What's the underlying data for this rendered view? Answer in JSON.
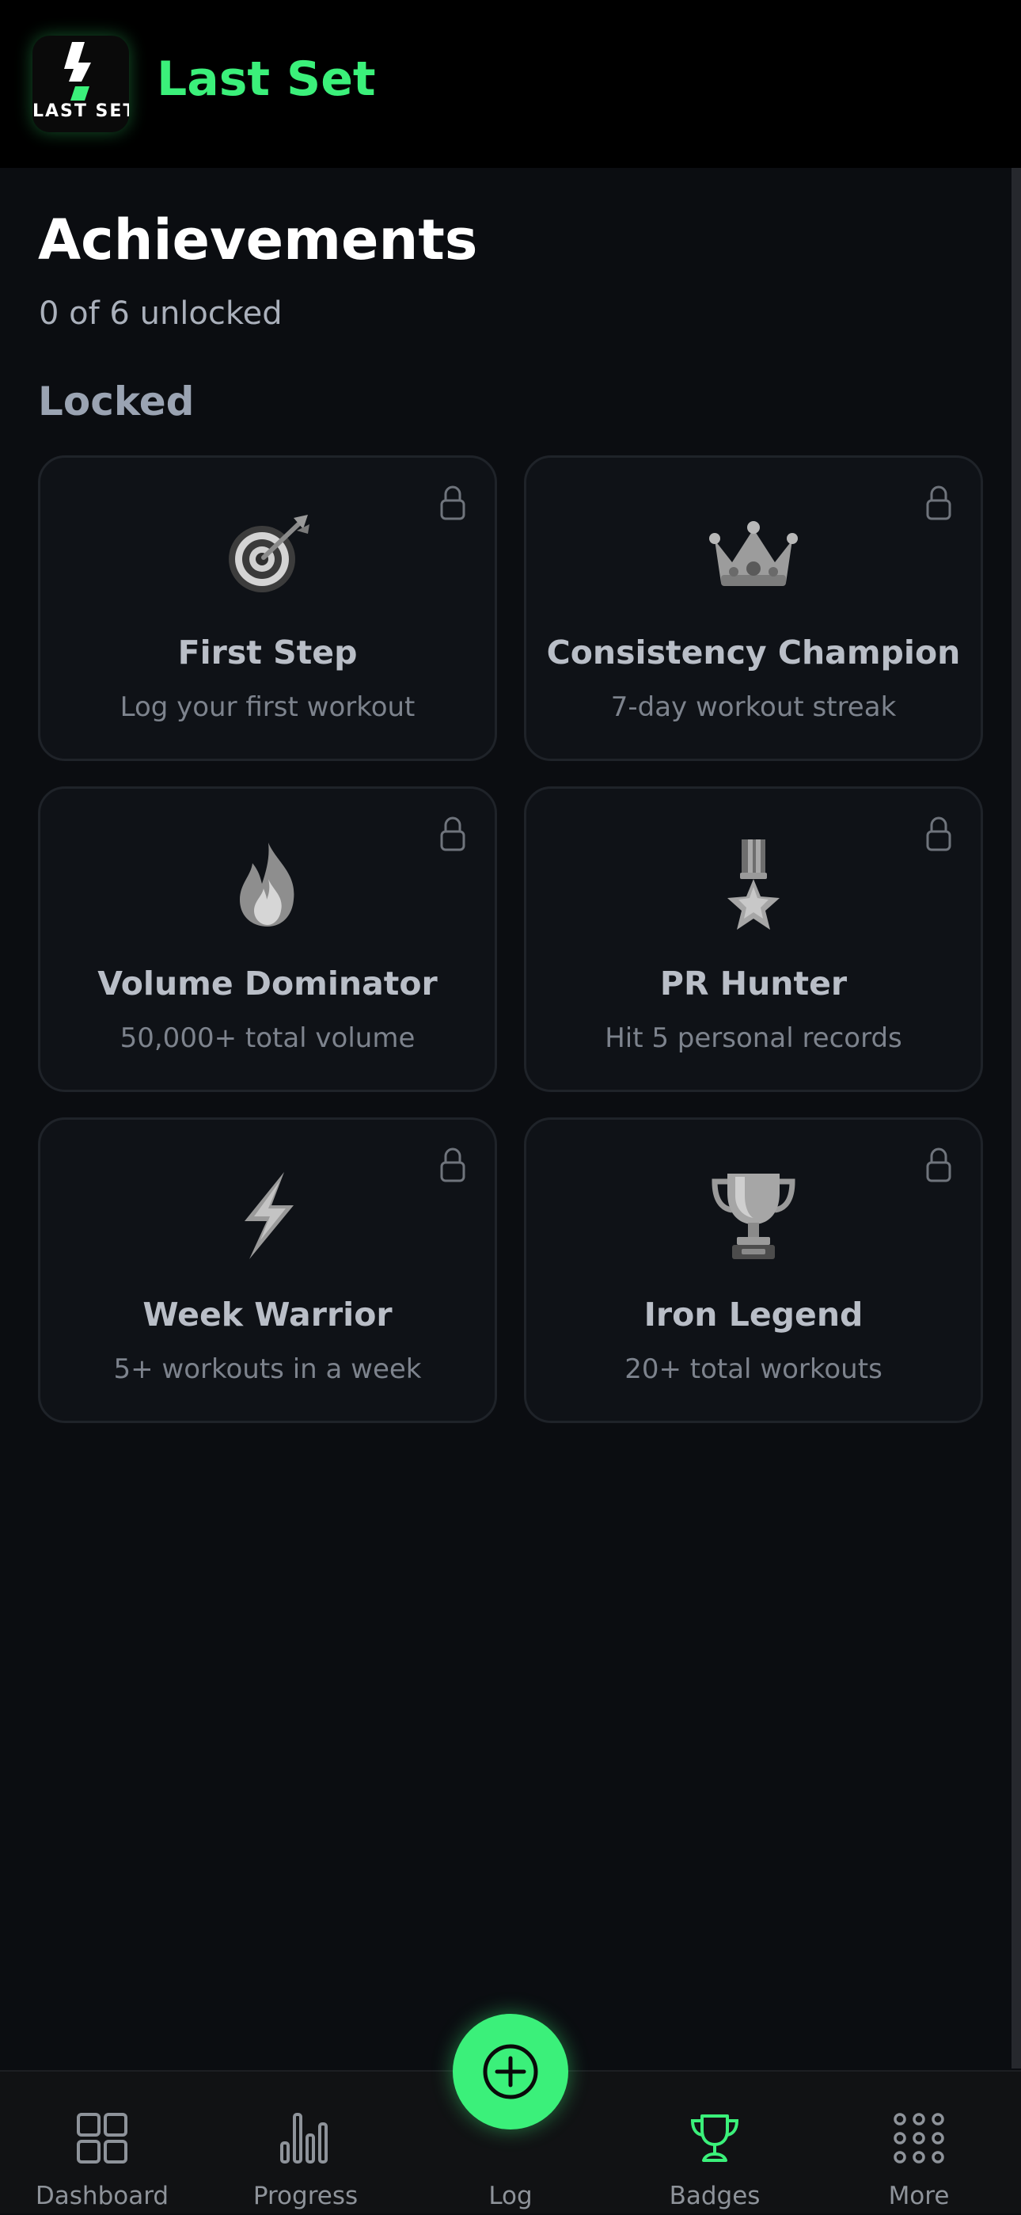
{
  "app": {
    "name": "Last Set",
    "logo_text": "LAST SET",
    "brand_color": "#3bf07a",
    "background_color": "#0b0d11"
  },
  "page": {
    "title": "Achievements",
    "subtitle": "0 of 6 unlocked"
  },
  "section": {
    "title": "Locked"
  },
  "badges": [
    {
      "name": "First Step",
      "description": "Log your first workout",
      "icon": "target-dart-icon",
      "locked": true
    },
    {
      "name": "Consistency Champion",
      "description": "7-day workout streak",
      "icon": "crown-icon",
      "locked": true
    },
    {
      "name": "Volume Dominator",
      "description": "50,000+ total volume",
      "icon": "fire-icon",
      "locked": true
    },
    {
      "name": "PR Hunter",
      "description": "Hit 5 personal records",
      "icon": "medal-icon",
      "locked": true
    },
    {
      "name": "Week Warrior",
      "description": "5+ workouts in a week",
      "icon": "lightning-icon",
      "locked": true
    },
    {
      "name": "Iron Legend",
      "description": "20+ total workouts",
      "icon": "trophy-icon",
      "locked": true
    }
  ],
  "nav": {
    "items": [
      {
        "label": "Dashboard",
        "icon": "dashboard-grid-icon",
        "active": false
      },
      {
        "label": "Progress",
        "icon": "bar-chart-icon",
        "active": false
      },
      {
        "label": "Log",
        "icon": "plus-circle-icon",
        "active": false
      },
      {
        "label": "Badges",
        "icon": "trophy-icon",
        "active": true
      },
      {
        "label": "More",
        "icon": "dots-grid-icon",
        "active": false
      }
    ]
  }
}
